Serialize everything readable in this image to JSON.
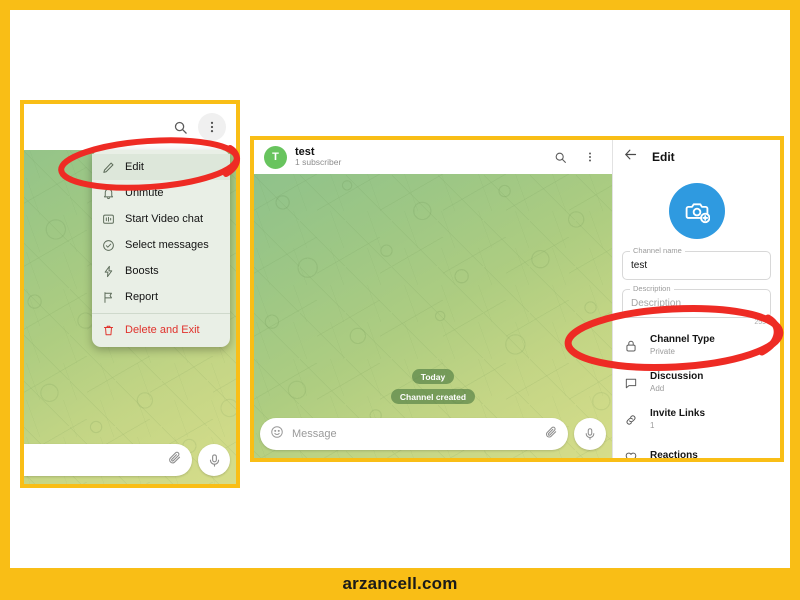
{
  "frame": {
    "accent_color": "#f9be16",
    "watermark": "arzancell.com"
  },
  "left_panel": {
    "topbar": {
      "search_icon": "search-icon",
      "overflow_icon": "more-vertical-icon"
    },
    "menu": {
      "items": [
        {
          "label": "Edit",
          "icon": "pencil-icon",
          "selected": true
        },
        {
          "label": "Unmute",
          "icon": "bell-icon",
          "selected": false
        },
        {
          "label": "Start Video chat",
          "icon": "video-chat-icon",
          "selected": false
        },
        {
          "label": "Select messages",
          "icon": "check-circle-icon",
          "selected": false
        },
        {
          "label": "Boosts",
          "icon": "boost-icon",
          "selected": false
        },
        {
          "label": "Report",
          "icon": "flag-icon",
          "selected": false
        },
        {
          "label": "Delete and Exit",
          "icon": "trash-icon",
          "selected": false,
          "danger": true
        }
      ]
    },
    "composer": {
      "attach_icon": "paperclip-icon",
      "mic_icon": "microphone-icon"
    }
  },
  "right_panel": {
    "chat": {
      "avatar_letter": "T",
      "avatar_color": "#68c45e",
      "title": "test",
      "subtitle": "1 subscriber",
      "search_icon": "search-icon",
      "overflow_icon": "more-vertical-icon",
      "service_badges": [
        "Today",
        "Channel created"
      ],
      "composer": {
        "emoji_icon": "smiley-icon",
        "placeholder": "Message",
        "attach_icon": "paperclip-icon",
        "mic_icon": "microphone-icon"
      }
    },
    "edit": {
      "back_icon": "arrow-back-icon",
      "title": "Edit",
      "avatar_upload": {
        "icon": "camera-plus-icon",
        "color": "#2f9ae0"
      },
      "fields": [
        {
          "label": "Channel name",
          "value": "test",
          "placeholder": ""
        },
        {
          "label": "Description",
          "value": "",
          "placeholder": "Description",
          "counter": "255"
        }
      ],
      "settings": [
        {
          "title": "Channel Type",
          "subtitle": "Private",
          "icon": "lock-icon"
        },
        {
          "title": "Discussion",
          "subtitle": "Add",
          "icon": "chat-bubble-icon"
        },
        {
          "title": "Invite Links",
          "subtitle": "1",
          "icon": "link-icon"
        },
        {
          "title": "Reactions",
          "subtitle": "",
          "icon": "heart-icon"
        }
      ]
    }
  },
  "annotations": {
    "color": "#ee2b24",
    "items": [
      {
        "name": "edit-menu-highlight",
        "target": "Edit"
      },
      {
        "name": "channel-type-highlight",
        "target": "Channel Type"
      }
    ]
  }
}
